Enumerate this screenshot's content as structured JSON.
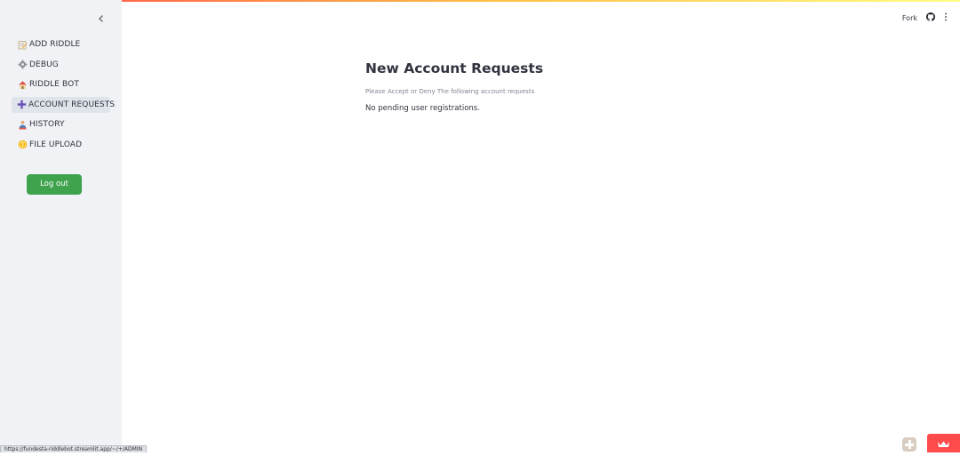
{
  "sidebar": {
    "collapse_icon": "chevron-left-icon",
    "items": [
      {
        "label": "ADD RIDDLE",
        "icon": "memo-pencil-icon"
      },
      {
        "label": "DEBUG",
        "icon": "gear-icon"
      },
      {
        "label": "RIDDLE BOT",
        "icon": "house-icon"
      },
      {
        "label": "ACCOUNT REQUESTS",
        "icon": "plus-icon",
        "active": true
      },
      {
        "label": "HISTORY",
        "icon": "person-icon"
      },
      {
        "label": "FILE UPLOAD",
        "icon": "coin-icon"
      }
    ],
    "logout_label": "Log out"
  },
  "header": {
    "fork_label": "Fork",
    "github_icon": "github-icon",
    "menu_icon": "kebab-menu-icon"
  },
  "main": {
    "title": "New Account Requests",
    "caption": "Please Accept or Deny The following account requests",
    "empty_message": "No pending user registrations."
  },
  "status_bar": {
    "url": "https://fundesta-riddlebot.streamlit.app/~/+/ADMIN"
  },
  "colors": {
    "sidebar_bg": "#f0f2f6",
    "active_item_bg": "#dfe3ea",
    "logout_button": "#3fa34d",
    "streamlit_red": "#ff4b4b"
  }
}
